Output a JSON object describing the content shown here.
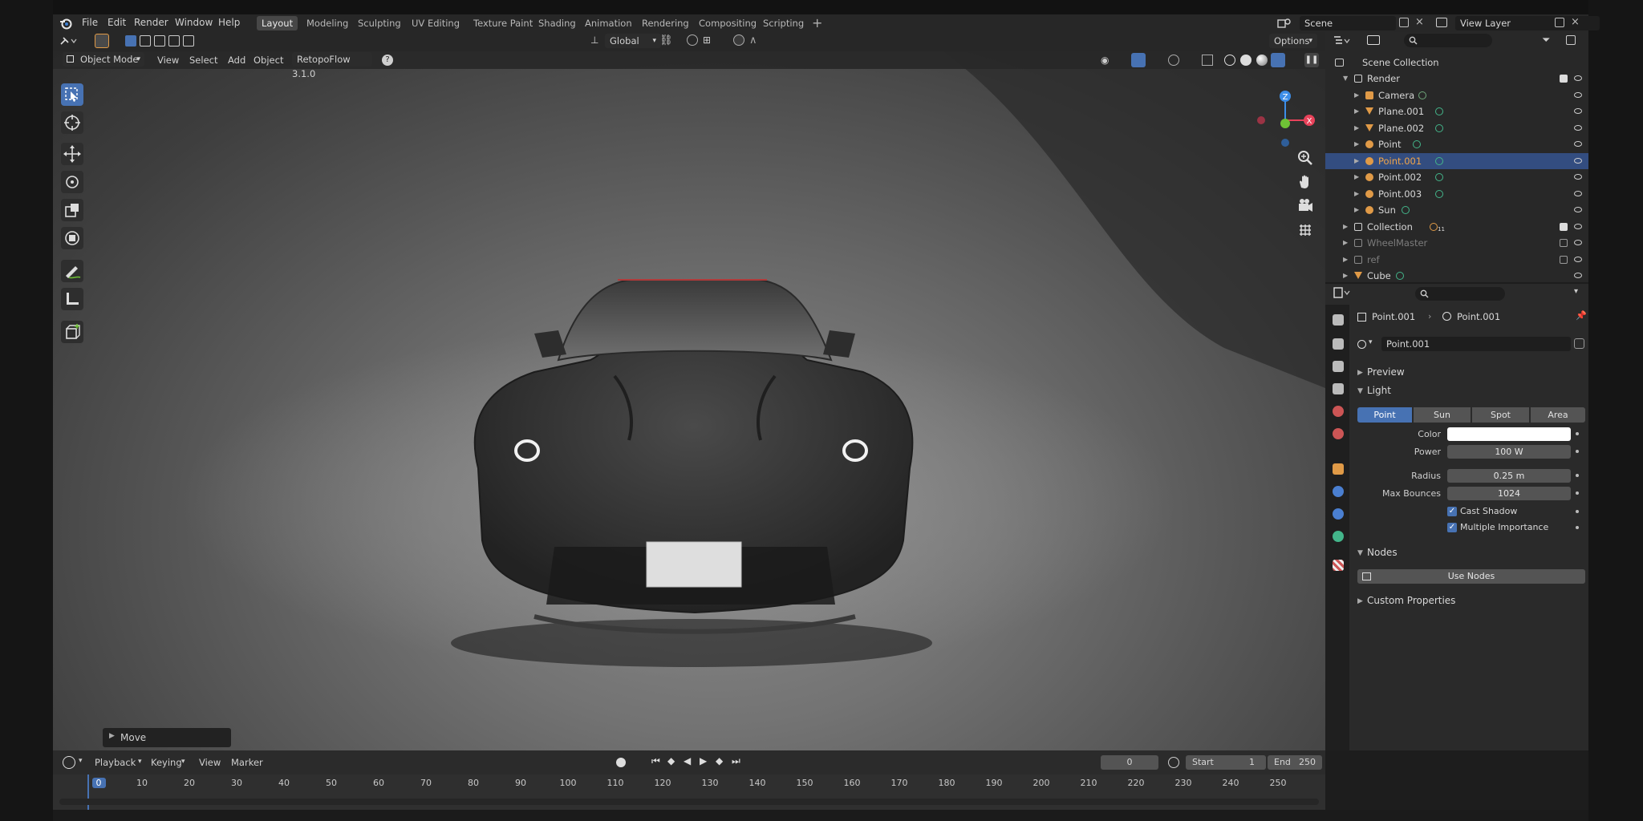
{
  "header": {
    "menus": [
      "File",
      "Edit",
      "Render",
      "Window",
      "Help"
    ],
    "workspaces": [
      "Layout",
      "Modeling",
      "Sculpting",
      "UV Editing",
      "Texture Paint",
      "Shading",
      "Animation",
      "Rendering",
      "Compositing",
      "Scripting"
    ],
    "active_workspace": "Layout",
    "scene_name": "Scene",
    "view_layer": "View Layer"
  },
  "viewport": {
    "transform_orientation": "Global",
    "mode": "Object Mode",
    "menus": [
      "View",
      "Select",
      "Add",
      "Object"
    ],
    "addon": "RetopoFlow 3.1.0",
    "options_label": "Options",
    "last_operator": "Move",
    "gizmo_labels": [
      "Z",
      "X"
    ]
  },
  "outliner": {
    "root": "Scene Collection",
    "rows": [
      {
        "name": "Render",
        "type": "collection",
        "indent": 1,
        "checked": true,
        "icon_color": "#d0d0d0"
      },
      {
        "name": "Camera",
        "type": "camera",
        "indent": 2,
        "icon_color": "#e09a47",
        "badge_color": "#6fa67a"
      },
      {
        "name": "Plane.001",
        "type": "mesh",
        "indent": 2,
        "icon_color": "#e09a47",
        "badge_color": "#43b58a"
      },
      {
        "name": "Plane.002",
        "type": "mesh",
        "indent": 2,
        "icon_color": "#e09a47",
        "badge_color": "#43b58a"
      },
      {
        "name": "Point",
        "type": "light",
        "indent": 2,
        "icon_color": "#e09a47",
        "badge_color": "#43b58a"
      },
      {
        "name": "Point.001",
        "type": "light",
        "indent": 2,
        "selected": true,
        "icon_color": "#e09a47",
        "badge_color": "#43b58a"
      },
      {
        "name": "Point.002",
        "type": "light",
        "indent": 2,
        "icon_color": "#e09a47",
        "badge_color": "#43b58a"
      },
      {
        "name": "Point.003",
        "type": "light",
        "indent": 2,
        "icon_color": "#e09a47",
        "badge_color": "#43b58a"
      },
      {
        "name": "Sun",
        "type": "light",
        "indent": 2,
        "icon_color": "#e09a47",
        "badge_color": "#43b58a"
      },
      {
        "name": "Collection",
        "type": "collection",
        "indent": 1,
        "checked": true,
        "icon_color": "#d0d0d0",
        "badge_color": "#e09a47",
        "badge_text": "11"
      },
      {
        "name": "WheelMaster",
        "type": "collection",
        "indent": 1,
        "checked": false,
        "dim": true,
        "icon_color": "#8a8a8a"
      },
      {
        "name": "ref",
        "type": "collection",
        "indent": 1,
        "checked": false,
        "dim": true,
        "icon_color": "#8a8a8a"
      },
      {
        "name": "Cube",
        "type": "mesh",
        "indent": 1,
        "icon_color": "#e09a47",
        "badge_color": "#43b58a"
      }
    ]
  },
  "properties": {
    "object_name": "Point.001",
    "data_name": "Point.001",
    "datablock": "Point.001",
    "panels": {
      "preview": "Preview",
      "light": "Light",
      "nodes": "Nodes",
      "custom": "Custom Properties"
    },
    "light_types": [
      "Point",
      "Sun",
      "Spot",
      "Area"
    ],
    "active_light_type": "Point",
    "fields": {
      "color_label": "Color",
      "color_value": "#ffffff",
      "power_label": "Power",
      "power_value": "100 W",
      "radius_label": "Radius",
      "radius_value": "0.25 m",
      "bounces_label": "Max Bounces",
      "bounces_value": "1024"
    },
    "checkboxes": {
      "cast_shadow": "Cast Shadow",
      "multiple_importance": "Multiple Importance"
    },
    "use_nodes": "Use Nodes"
  },
  "timeline": {
    "menus": [
      "Playback",
      "Keying",
      "View",
      "Marker"
    ],
    "current_frame": "0",
    "start_label": "Start",
    "start": "1",
    "end_label": "End",
    "end": "250",
    "ticks": [
      "0",
      "10",
      "20",
      "30",
      "40",
      "50",
      "60",
      "70",
      "80",
      "90",
      "100",
      "110",
      "120",
      "130",
      "140",
      "150",
      "160",
      "170",
      "180",
      "190",
      "200",
      "210",
      "220",
      "230",
      "240",
      "250"
    ]
  },
  "colors": {
    "accent": "#4772b3",
    "selection": "#334d80",
    "axis_x": "#e8425a",
    "axis_y": "#6fc236",
    "axis_z": "#3d8ee8",
    "object_orange": "#e09a47",
    "light_green": "#43b58a"
  }
}
